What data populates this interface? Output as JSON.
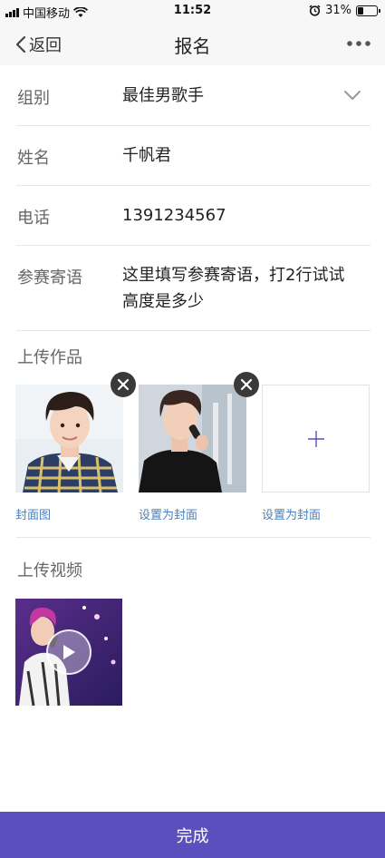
{
  "status_bar": {
    "carrier": "中国移动",
    "time": "11:52",
    "battery_text": "31%",
    "battery_level": 0.31,
    "icons": [
      "signal-icon",
      "wifi-icon",
      "alarm-icon",
      "battery-icon"
    ]
  },
  "nav": {
    "back_label": "返回",
    "title": "报名",
    "more_icon": "more-dots-icon"
  },
  "form": {
    "group": {
      "label": "组别",
      "value": "最佳男歌手"
    },
    "name": {
      "label": "姓名",
      "value": "千帆君"
    },
    "phone": {
      "label": "电话",
      "value": "1391234567"
    },
    "message": {
      "label": "参赛寄语",
      "value_line1": "这里填写参赛寄语，打2行试试",
      "value_line2": "高度是多少"
    }
  },
  "works": {
    "title": "上传作品",
    "items": [
      {
        "caption": "封面图"
      },
      {
        "caption": "设置为封面"
      },
      {
        "caption": "设置为封面"
      }
    ],
    "add_icon": "plus-icon"
  },
  "video": {
    "title": "上传视频",
    "play_icon": "play-icon"
  },
  "submit": {
    "label": "完成"
  },
  "colors": {
    "accent": "#5b4fbd",
    "link": "#4a7fb8",
    "nav_bg": "#f7f7f7",
    "divider": "#e6e6e6"
  }
}
